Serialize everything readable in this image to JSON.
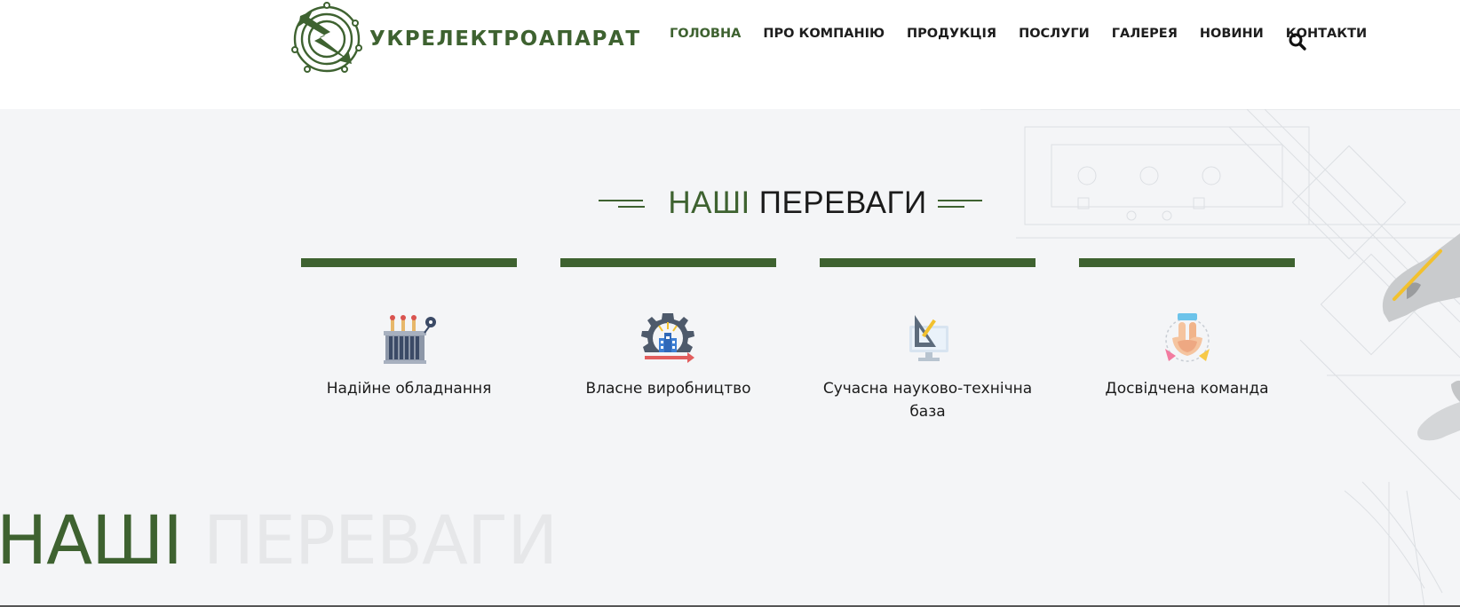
{
  "brand": {
    "name": "УКРЕЛЕКТРОАПАРАТ",
    "logo_icon": "lightning-circuit-logo",
    "color": "#3e6230"
  },
  "nav": {
    "items": [
      {
        "label": "ГОЛОВНА",
        "active": true
      },
      {
        "label": "ПРО КОМПАНІЮ"
      },
      {
        "label": "ПРОДУКЦІЯ"
      },
      {
        "label": "ПОСЛУГИ"
      },
      {
        "label": "ГАЛЕРЕЯ"
      },
      {
        "label": "НОВИНИ"
      },
      {
        "label": "КОНТАКТИ"
      }
    ],
    "search_icon": "search-icon"
  },
  "advantages": {
    "title_accent": "НАШІ",
    "title_main": "ПЕРЕВАГИ",
    "items": [
      {
        "label": "Надійне обладнання",
        "icon": "transformer-icon"
      },
      {
        "label": "Власне виробництво",
        "icon": "factory-gear-icon"
      },
      {
        "label": "Сучасна науково-технічна база",
        "icon": "drafting-monitor-icon"
      },
      {
        "label": "Досвідчена команда",
        "icon": "team-hands-icon"
      }
    ]
  },
  "watermark": {
    "accent": "НАШІ",
    "faded": "ПЕРЕВАГИ"
  },
  "colors": {
    "accent": "#3e6230",
    "section_bg": "#f4f5f7",
    "watermark": "#e6e7e9"
  }
}
